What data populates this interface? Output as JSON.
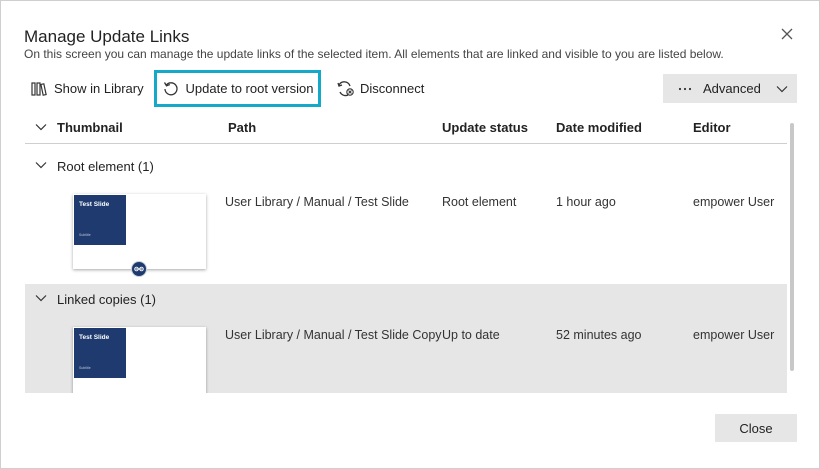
{
  "dialog": {
    "title": "Manage Update Links",
    "subtitle": "On this screen you can manage the update links of the selected item. All elements that are linked and visible to you are listed below."
  },
  "toolbar": {
    "show_in_library": "Show in Library",
    "update_to_root": "Update to root version",
    "disconnect": "Disconnect",
    "advanced": "Advanced"
  },
  "columns": {
    "thumbnail": "Thumbnail",
    "path": "Path",
    "update_status": "Update status",
    "date_modified": "Date modified",
    "editor": "Editor"
  },
  "groups": [
    {
      "label": "Root element (1)",
      "rows": [
        {
          "slide_title": "Test Slide",
          "slide_subtitle": "Subtitle",
          "path": "User Library / Manual / Test Slide",
          "status": "Root element",
          "date": "1 hour ago",
          "editor": "empower User"
        }
      ]
    },
    {
      "label": "Linked copies (1)",
      "rows": [
        {
          "slide_title": "Test Slide",
          "slide_subtitle": "Subtitle",
          "path": "User Library / Manual / Test Slide Copy",
          "status": "Up to date",
          "date": "52 minutes ago",
          "editor": "empower User"
        }
      ]
    }
  ],
  "footer": {
    "close": "Close"
  },
  "colors": {
    "highlight": "#14a9c8",
    "slide_bg": "#1f3a6e",
    "selected_row": "#e6e6e6",
    "button_bg": "#e6e6e6"
  },
  "icons": [
    "close-icon",
    "library-icon",
    "refresh-icon",
    "disconnect-icon",
    "ellipsis-icon",
    "chevron-down-icon",
    "link-icon"
  ]
}
